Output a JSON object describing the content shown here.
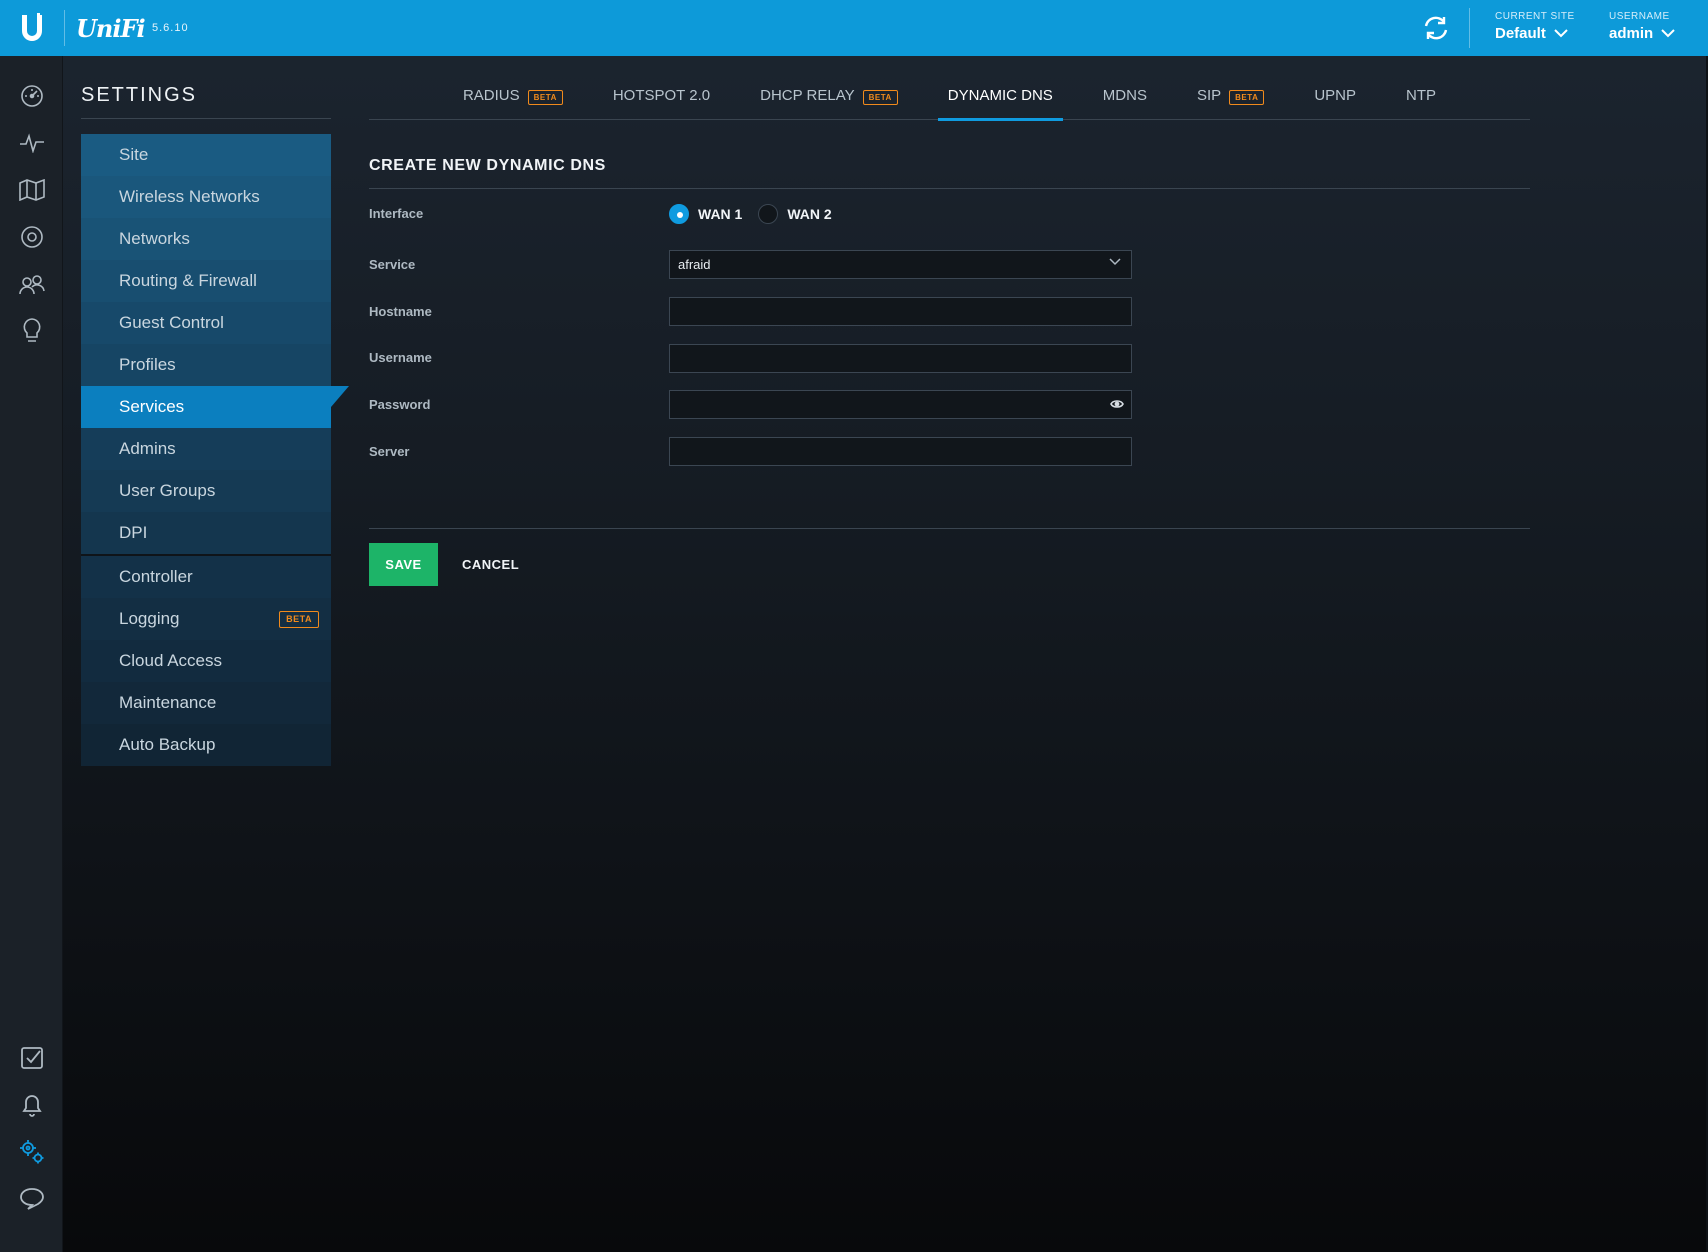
{
  "topbar": {
    "brand": "UniFi",
    "version": "5.6.10",
    "site_caption": "CURRENT SITE",
    "site_value": "Default",
    "user_caption": "USERNAME",
    "user_value": "admin"
  },
  "rail": {
    "icons": [
      "dashboard-icon",
      "statistics-icon",
      "map-icon",
      "devices-icon",
      "clients-icon",
      "insights-icon",
      "alerts-icon",
      "events-icon",
      "settings-icon",
      "chat-icon"
    ],
    "active_color": "#0f9be0"
  },
  "settings": {
    "title": "SETTINGS",
    "menu": [
      {
        "label": "Site"
      },
      {
        "label": "Wireless Networks"
      },
      {
        "label": "Networks"
      },
      {
        "label": "Routing & Firewall"
      },
      {
        "label": "Guest Control"
      },
      {
        "label": "Profiles"
      },
      {
        "label": "Services",
        "active": true
      },
      {
        "label": "Admins"
      },
      {
        "label": "User Groups"
      },
      {
        "label": "DPI"
      },
      {
        "label": "Controller"
      },
      {
        "label": "Logging",
        "badge": "BETA"
      },
      {
        "label": "Cloud Access"
      },
      {
        "label": "Maintenance"
      },
      {
        "label": "Auto Backup"
      }
    ]
  },
  "tabs": [
    {
      "label": "RADIUS",
      "badge": "BETA"
    },
    {
      "label": "HOTSPOT 2.0"
    },
    {
      "label": "DHCP RELAY",
      "badge": "BETA"
    },
    {
      "label": "DYNAMIC DNS",
      "active": true
    },
    {
      "label": "MDNS"
    },
    {
      "label": "SIP",
      "badge": "BETA"
    },
    {
      "label": "UPNP"
    },
    {
      "label": "NTP"
    }
  ],
  "form": {
    "title": "CREATE NEW DYNAMIC DNS",
    "interface_label": "Interface",
    "interface_options": [
      "WAN 1",
      "WAN 2"
    ],
    "interface_selected": "WAN 1",
    "service_label": "Service",
    "service_value": "afraid",
    "hostname_label": "Hostname",
    "hostname_value": "",
    "username_label": "Username",
    "username_value": "",
    "password_label": "Password",
    "password_value": "",
    "server_label": "Server",
    "server_value": "",
    "save_label": "SAVE",
    "cancel_label": "CANCEL"
  },
  "colors": {
    "topbar": "#0d9ad9",
    "accent": "#0f9be0",
    "active_menu": "#0b7fbf",
    "save": "#1db468",
    "beta": "#f08a1c"
  }
}
